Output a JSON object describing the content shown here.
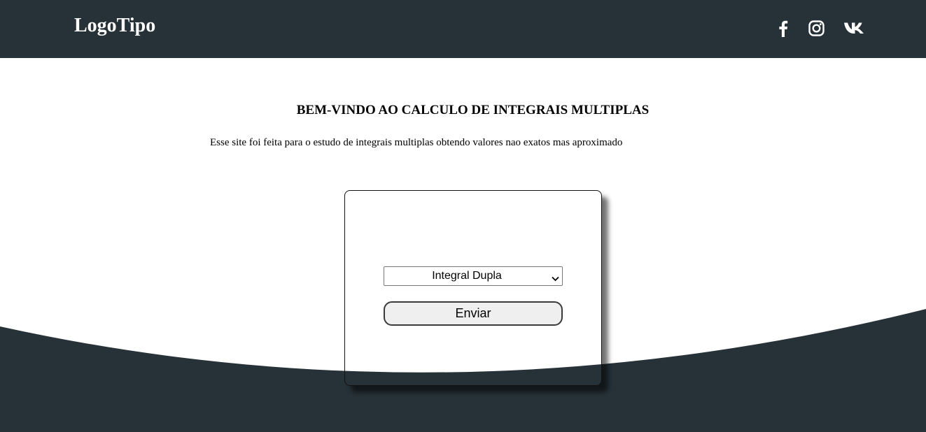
{
  "header": {
    "logo": "LogoTipo",
    "social": [
      "facebook-icon",
      "instagram-icon",
      "vk-icon"
    ]
  },
  "main": {
    "title": "BEM-VINDO AO CALCULO DE INTEGRAIS MULTIPLAS",
    "description": "Esse site foi feita para o estudo de integrais multiplas obtendo valores nao exatos mas aproximado"
  },
  "form": {
    "select_value": "Integral Dupla",
    "submit_label": "Enviar"
  },
  "colors": {
    "dark": "#263238",
    "background": "#ffffff"
  }
}
